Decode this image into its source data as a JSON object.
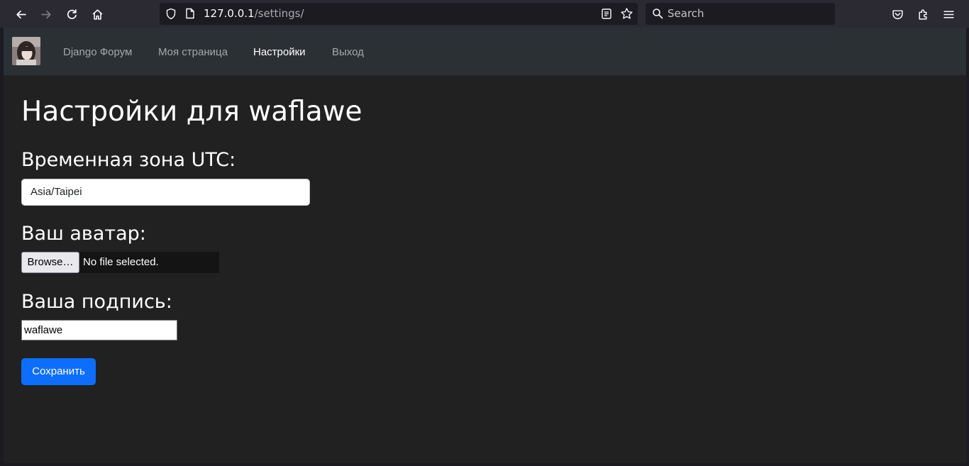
{
  "browser": {
    "url_host": "127.0.0.1",
    "url_path": "/settings/",
    "search_placeholder": "Search"
  },
  "navbar": {
    "brand": "Django Форум",
    "links": [
      {
        "label": "Моя страница",
        "active": false
      },
      {
        "label": "Настройки",
        "active": true
      },
      {
        "label": "Выход",
        "active": false
      }
    ]
  },
  "page": {
    "title": "Настройки для waflawe",
    "timezone_label": "Временная зона UTC:",
    "timezone_value": "Asia/Taipei",
    "avatar_label": "Ваш аватар:",
    "browse_button": "Browse…",
    "file_status": "No file selected.",
    "signature_label": "Ваша подпись:",
    "signature_value": "waflawe",
    "save_button": "Сохранить"
  },
  "colors": {
    "accent": "#0d6efd",
    "navbar_bg": "#2b3035",
    "page_bg": "#212121"
  }
}
